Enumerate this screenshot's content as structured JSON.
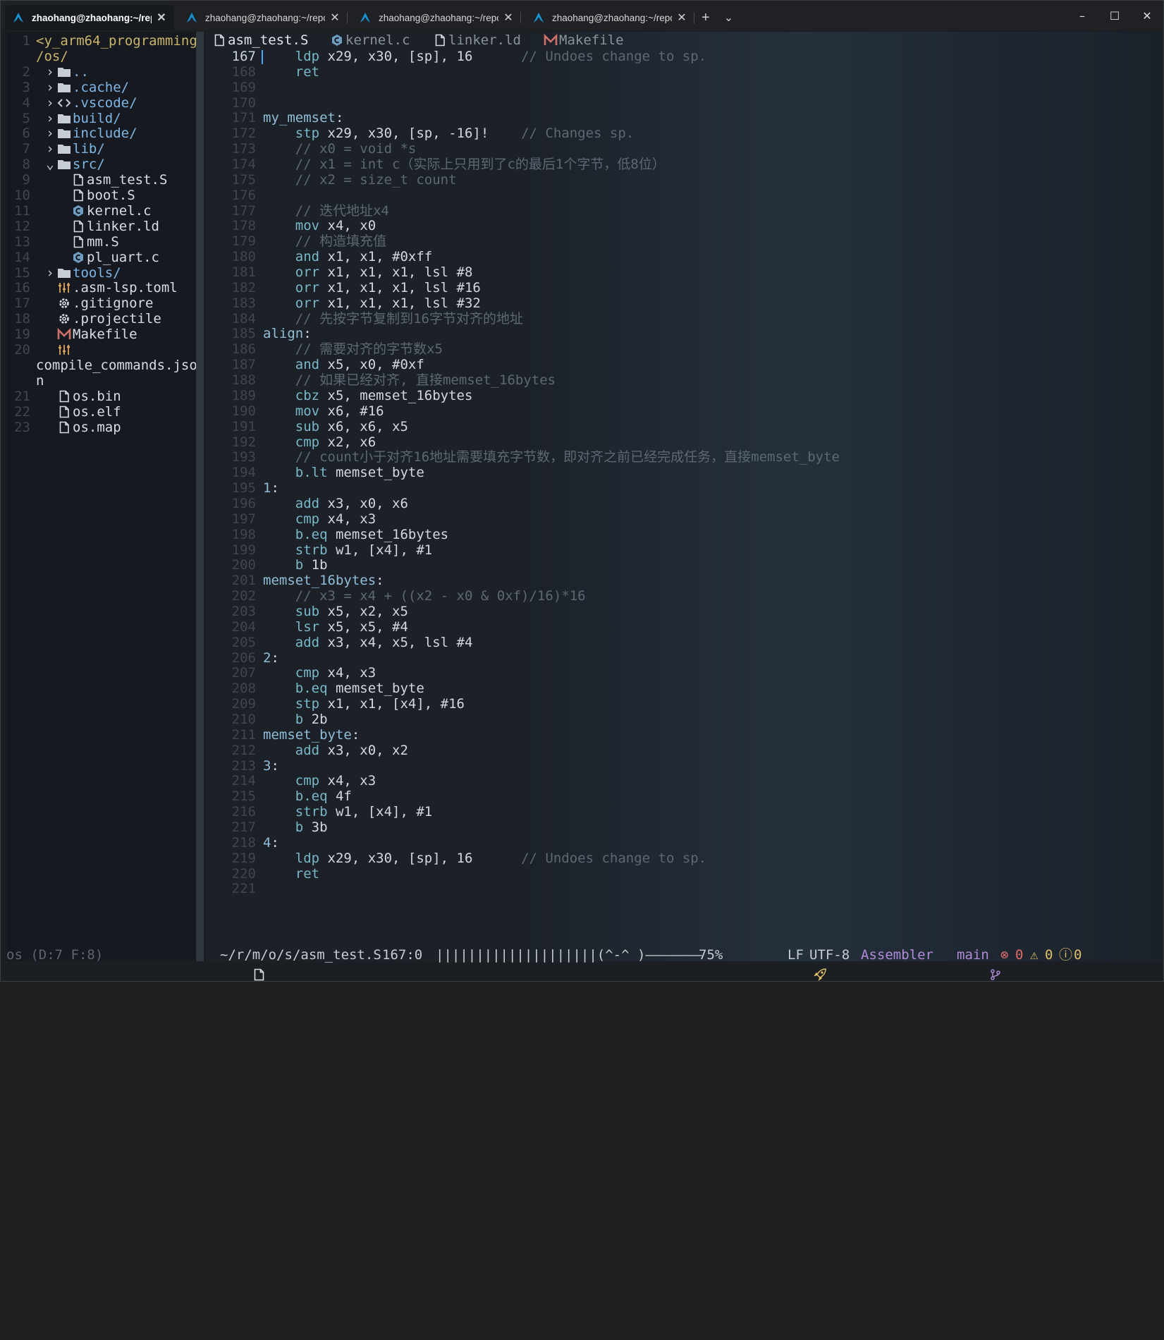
{
  "terminal": {
    "tabs": [
      {
        "title": "zhaohang@zhaohang:~/repos",
        "active": true
      },
      {
        "title": "zhaohang@zhaohang:~/reposi",
        "active": false
      },
      {
        "title": "zhaohang@zhaohang:~/reposi",
        "active": false
      },
      {
        "title": "zhaohang@zhaohang:~/reposi",
        "active": false
      }
    ],
    "new_tab_label": "+",
    "dropdown_label": "⌄",
    "window_controls": {
      "minimize": "–",
      "maximize": "☐",
      "close": "✕"
    }
  },
  "sidebar": {
    "rows": [
      {
        "n": "1",
        "text": "<y_arm64_programming\\",
        "type": "header",
        "indent": 0,
        "icon": ""
      },
      {
        "n": "",
        "text": "/os/",
        "type": "header",
        "indent": 0,
        "icon": ""
      },
      {
        "n": "2",
        "text": "..",
        "type": "dir",
        "indent": 1,
        "icon": "folder-icon",
        "chev": "›"
      },
      {
        "n": "3",
        "text": ".cache/",
        "type": "dir",
        "indent": 1,
        "icon": "folder-icon",
        "chev": "›"
      },
      {
        "n": "4",
        "text": ".vscode/",
        "type": "dir",
        "indent": 1,
        "icon": "code-folder-icon",
        "chev": "›"
      },
      {
        "n": "5",
        "text": "build/",
        "type": "dir",
        "indent": 1,
        "icon": "folder-icon",
        "chev": "›"
      },
      {
        "n": "6",
        "text": "include/",
        "type": "dir",
        "indent": 1,
        "icon": "folder-icon",
        "chev": "›"
      },
      {
        "n": "7",
        "text": "lib/",
        "type": "dir",
        "indent": 1,
        "icon": "folder-icon",
        "chev": "›"
      },
      {
        "n": "8",
        "text": "src/",
        "type": "dir",
        "indent": 1,
        "icon": "folder-open-icon",
        "chev": "⌄"
      },
      {
        "n": "9",
        "text": "asm_test.S",
        "type": "file",
        "indent": 2,
        "icon": "file-icon"
      },
      {
        "n": "10",
        "text": "boot.S",
        "type": "file",
        "indent": 2,
        "icon": "file-icon"
      },
      {
        "n": "11",
        "text": "kernel.c",
        "type": "file",
        "indent": 2,
        "icon": "c-file-icon"
      },
      {
        "n": "12",
        "text": "linker.ld",
        "type": "file",
        "indent": 2,
        "icon": "file-icon"
      },
      {
        "n": "13",
        "text": "mm.S",
        "type": "file",
        "indent": 2,
        "icon": "file-icon"
      },
      {
        "n": "14",
        "text": "pl_uart.c",
        "type": "file",
        "indent": 2,
        "icon": "c-file-icon"
      },
      {
        "n": "15",
        "text": "tools/",
        "type": "dir",
        "indent": 1,
        "icon": "folder-icon",
        "chev": "›"
      },
      {
        "n": "16",
        "text": ".asm-lsp.toml",
        "type": "file",
        "indent": 1,
        "icon": "settings-sliders-icon"
      },
      {
        "n": "17",
        "text": ".gitignore",
        "type": "file",
        "indent": 1,
        "icon": "gear-icon"
      },
      {
        "n": "18",
        "text": ".projectile",
        "type": "file",
        "indent": 1,
        "icon": "gear-icon"
      },
      {
        "n": "19",
        "text": "Makefile",
        "type": "file",
        "indent": 1,
        "icon": "makefile-icon"
      },
      {
        "n": "20",
        "text": "",
        "type": "file",
        "indent": 1,
        "icon": "settings-sliders-icon"
      },
      {
        "n": "",
        "text": "compile_commands.jso\\",
        "type": "file",
        "indent": 0,
        "icon": ""
      },
      {
        "n": "",
        "text": "n",
        "type": "file",
        "indent": 0,
        "icon": ""
      },
      {
        "n": "21",
        "text": "os.bin",
        "type": "file",
        "indent": 1,
        "icon": "file-icon"
      },
      {
        "n": "22",
        "text": "os.elf",
        "type": "file",
        "indent": 1,
        "icon": "file-icon"
      },
      {
        "n": "23",
        "text": "os.map",
        "type": "file",
        "indent": 1,
        "icon": "file-icon"
      }
    ],
    "footer": "os (D:7 F:8)"
  },
  "editor": {
    "tabs": [
      {
        "label": "asm_test.S",
        "icon": "file-icon",
        "active": true
      },
      {
        "label": "kernel.c",
        "icon": "c-file-icon",
        "active": false
      },
      {
        "label": "linker.ld",
        "icon": "file-icon",
        "active": false
      },
      {
        "label": "Makefile",
        "icon": "makefile-icon",
        "active": false
      }
    ],
    "current_line": "167",
    "lines": [
      {
        "n": "167",
        "seg": [
          [
            "    ",
            ""
          ],
          [
            "ldp",
            "kw"
          ],
          [
            " x29, x30, [sp], 16      ",
            ""
          ],
          [
            "// Undoes change to sp.",
            "cmt"
          ]
        ]
      },
      {
        "n": "168",
        "seg": [
          [
            "    ",
            ""
          ],
          [
            "ret",
            "kw"
          ]
        ]
      },
      {
        "n": "169",
        "seg": []
      },
      {
        "n": "170",
        "seg": []
      },
      {
        "n": "171",
        "seg": [
          [
            "my_memset",
            "lbl"
          ],
          [
            ":",
            ""
          ]
        ]
      },
      {
        "n": "172",
        "seg": [
          [
            "    ",
            ""
          ],
          [
            "stp",
            "kw"
          ],
          [
            " x29, x30, [sp, -16]!    ",
            ""
          ],
          [
            "// Changes sp.",
            "cmt"
          ]
        ]
      },
      {
        "n": "173",
        "seg": [
          [
            "    ",
            ""
          ],
          [
            "// x0 = void *s",
            "cmt"
          ]
        ]
      },
      {
        "n": "174",
        "seg": [
          [
            "    ",
            ""
          ],
          [
            "// x1 = int c（实际上只用到了c的最后1个字节，低8位）",
            "cmt"
          ]
        ]
      },
      {
        "n": "175",
        "seg": [
          [
            "    ",
            ""
          ],
          [
            "// x2 = size_t count",
            "cmt"
          ]
        ]
      },
      {
        "n": "176",
        "seg": []
      },
      {
        "n": "177",
        "seg": [
          [
            "    ",
            ""
          ],
          [
            "// 迭代地址x4",
            "cmt"
          ]
        ]
      },
      {
        "n": "178",
        "seg": [
          [
            "    ",
            ""
          ],
          [
            "mov",
            "kw"
          ],
          [
            " x4, x0",
            ""
          ]
        ]
      },
      {
        "n": "179",
        "seg": [
          [
            "    ",
            ""
          ],
          [
            "// 构造填充值",
            "cmt"
          ]
        ]
      },
      {
        "n": "180",
        "seg": [
          [
            "    ",
            ""
          ],
          [
            "and",
            "kw"
          ],
          [
            " x1, x1, #0xff",
            ""
          ]
        ]
      },
      {
        "n": "181",
        "seg": [
          [
            "    ",
            ""
          ],
          [
            "orr",
            "kw"
          ],
          [
            " x1, x1, x1, lsl #8",
            ""
          ]
        ]
      },
      {
        "n": "182",
        "seg": [
          [
            "    ",
            ""
          ],
          [
            "orr",
            "kw"
          ],
          [
            " x1, x1, x1, lsl #16",
            ""
          ]
        ]
      },
      {
        "n": "183",
        "seg": [
          [
            "    ",
            ""
          ],
          [
            "orr",
            "kw"
          ],
          [
            " x1, x1, x1, lsl #32",
            ""
          ]
        ]
      },
      {
        "n": "184",
        "seg": [
          [
            "    ",
            ""
          ],
          [
            "// 先按字节复制到16字节对齐的地址",
            "cmt"
          ]
        ]
      },
      {
        "n": "185",
        "seg": [
          [
            "align",
            "lbl"
          ],
          [
            ":",
            ""
          ]
        ]
      },
      {
        "n": "186",
        "seg": [
          [
            "    ",
            ""
          ],
          [
            "// 需要对齐的字节数x5",
            "cmt"
          ]
        ]
      },
      {
        "n": "187",
        "seg": [
          [
            "    ",
            ""
          ],
          [
            "and",
            "kw"
          ],
          [
            " x5, x0, #0xf",
            ""
          ]
        ]
      },
      {
        "n": "188",
        "seg": [
          [
            "    ",
            ""
          ],
          [
            "// 如果已经对齐, 直接memset_16bytes",
            "cmt"
          ]
        ]
      },
      {
        "n": "189",
        "seg": [
          [
            "    ",
            ""
          ],
          [
            "cbz",
            "kw"
          ],
          [
            " x5, memset_16bytes",
            ""
          ]
        ]
      },
      {
        "n": "190",
        "seg": [
          [
            "    ",
            ""
          ],
          [
            "mov",
            "kw"
          ],
          [
            " x6, #16",
            ""
          ]
        ]
      },
      {
        "n": "191",
        "seg": [
          [
            "    ",
            ""
          ],
          [
            "sub",
            "kw"
          ],
          [
            " x6, x6, x5",
            ""
          ]
        ]
      },
      {
        "n": "192",
        "seg": [
          [
            "    ",
            ""
          ],
          [
            "cmp",
            "kw"
          ],
          [
            " x2, x6",
            ""
          ]
        ]
      },
      {
        "n": "193",
        "seg": [
          [
            "    ",
            ""
          ],
          [
            "// count小于对齐16地址需要填充字节数，即对齐之前已经完成任务，直接memset_byte",
            "cmt"
          ]
        ]
      },
      {
        "n": "194",
        "seg": [
          [
            "    ",
            ""
          ],
          [
            "b.lt",
            "kw"
          ],
          [
            " memset_byte",
            ""
          ]
        ]
      },
      {
        "n": "195",
        "seg": [
          [
            "1",
            "lbl"
          ],
          [
            ":",
            ""
          ]
        ]
      },
      {
        "n": "196",
        "seg": [
          [
            "    ",
            ""
          ],
          [
            "add",
            "kw"
          ],
          [
            " x3, x0, x6",
            ""
          ]
        ]
      },
      {
        "n": "197",
        "seg": [
          [
            "    ",
            ""
          ],
          [
            "cmp",
            "kw"
          ],
          [
            " x4, x3",
            ""
          ]
        ]
      },
      {
        "n": "198",
        "seg": [
          [
            "    ",
            ""
          ],
          [
            "b.eq",
            "kw"
          ],
          [
            " memset_16bytes",
            ""
          ]
        ]
      },
      {
        "n": "199",
        "seg": [
          [
            "    ",
            ""
          ],
          [
            "strb",
            "kw"
          ],
          [
            " w1, [x4], #1",
            ""
          ]
        ]
      },
      {
        "n": "200",
        "seg": [
          [
            "    ",
            ""
          ],
          [
            "b",
            "kw"
          ],
          [
            " 1b",
            ""
          ]
        ]
      },
      {
        "n": "201",
        "seg": [
          [
            "memset_16bytes",
            "lbl"
          ],
          [
            ":",
            ""
          ]
        ]
      },
      {
        "n": "202",
        "seg": [
          [
            "    ",
            ""
          ],
          [
            "// x3 = x4 + ((x2 - x0 & 0xf)/16)*16",
            "cmt"
          ]
        ]
      },
      {
        "n": "203",
        "seg": [
          [
            "    ",
            ""
          ],
          [
            "sub",
            "kw"
          ],
          [
            " x5, x2, x5",
            ""
          ]
        ]
      },
      {
        "n": "204",
        "seg": [
          [
            "    ",
            ""
          ],
          [
            "lsr",
            "kw"
          ],
          [
            " x5, x5, #4",
            ""
          ]
        ]
      },
      {
        "n": "205",
        "seg": [
          [
            "    ",
            ""
          ],
          [
            "add",
            "kw"
          ],
          [
            " x3, x4, x5, lsl #4",
            ""
          ]
        ]
      },
      {
        "n": "206",
        "seg": [
          [
            "2",
            "lbl"
          ],
          [
            ":",
            ""
          ]
        ]
      },
      {
        "n": "207",
        "seg": [
          [
            "    ",
            ""
          ],
          [
            "cmp",
            "kw"
          ],
          [
            " x4, x3",
            ""
          ]
        ]
      },
      {
        "n": "208",
        "seg": [
          [
            "    ",
            ""
          ],
          [
            "b.eq",
            "kw"
          ],
          [
            " memset_byte",
            ""
          ]
        ]
      },
      {
        "n": "209",
        "seg": [
          [
            "    ",
            ""
          ],
          [
            "stp",
            "kw"
          ],
          [
            " x1, x1, [x4], #16",
            ""
          ]
        ]
      },
      {
        "n": "210",
        "seg": [
          [
            "    ",
            ""
          ],
          [
            "b",
            "kw"
          ],
          [
            " 2b",
            ""
          ]
        ]
      },
      {
        "n": "211",
        "seg": [
          [
            "memset_byte",
            "lbl"
          ],
          [
            ":",
            ""
          ]
        ]
      },
      {
        "n": "212",
        "seg": [
          [
            "    ",
            ""
          ],
          [
            "add",
            "kw"
          ],
          [
            " x3, x0, x2",
            ""
          ]
        ]
      },
      {
        "n": "213",
        "seg": [
          [
            "3",
            "lbl"
          ],
          [
            ":",
            ""
          ]
        ]
      },
      {
        "n": "214",
        "seg": [
          [
            "    ",
            ""
          ],
          [
            "cmp",
            "kw"
          ],
          [
            " x4, x3",
            ""
          ]
        ]
      },
      {
        "n": "215",
        "seg": [
          [
            "    ",
            ""
          ],
          [
            "b.eq",
            "kw"
          ],
          [
            " 4f",
            ""
          ]
        ]
      },
      {
        "n": "216",
        "seg": [
          [
            "    ",
            ""
          ],
          [
            "strb",
            "kw"
          ],
          [
            " w1, [x4], #1",
            ""
          ]
        ]
      },
      {
        "n": "217",
        "seg": [
          [
            "    ",
            ""
          ],
          [
            "b",
            "kw"
          ],
          [
            " 3b",
            ""
          ]
        ]
      },
      {
        "n": "218",
        "seg": [
          [
            "4",
            "lbl"
          ],
          [
            ":",
            ""
          ]
        ]
      },
      {
        "n": "219",
        "seg": [
          [
            "    ",
            ""
          ],
          [
            "ldp",
            "kw"
          ],
          [
            " x29, x30, [sp], 16      ",
            ""
          ],
          [
            "// Undoes change to sp.",
            "cmt"
          ]
        ]
      },
      {
        "n": "220",
        "seg": [
          [
            "    ",
            ""
          ],
          [
            "ret",
            "kw"
          ]
        ]
      },
      {
        "n": "221",
        "seg": []
      }
    ]
  },
  "statusbar": {
    "path": "~/r/m/o/s/asm_test.S",
    "position": "167:0",
    "progress_art": "||||||||||||||||||||(^-^ )———————",
    "percent": "75%",
    "eol": "LF",
    "encoding": "UTF-8",
    "mode": "Assembler",
    "branch": "main",
    "errors": "0",
    "warnings": "0",
    "infos": "0"
  },
  "colors": {
    "background": "#1b1f24",
    "keyword": "#78b8c8",
    "label": "#90bed9",
    "comment": "#5d6873",
    "directory": "#7fb6e6",
    "header_path": "#c9b46a",
    "mode": "#b08cd8",
    "accent_blue": "#4fa3ff",
    "error_red": "#e06c6c",
    "warning_yellow": "#e2c06a"
  }
}
